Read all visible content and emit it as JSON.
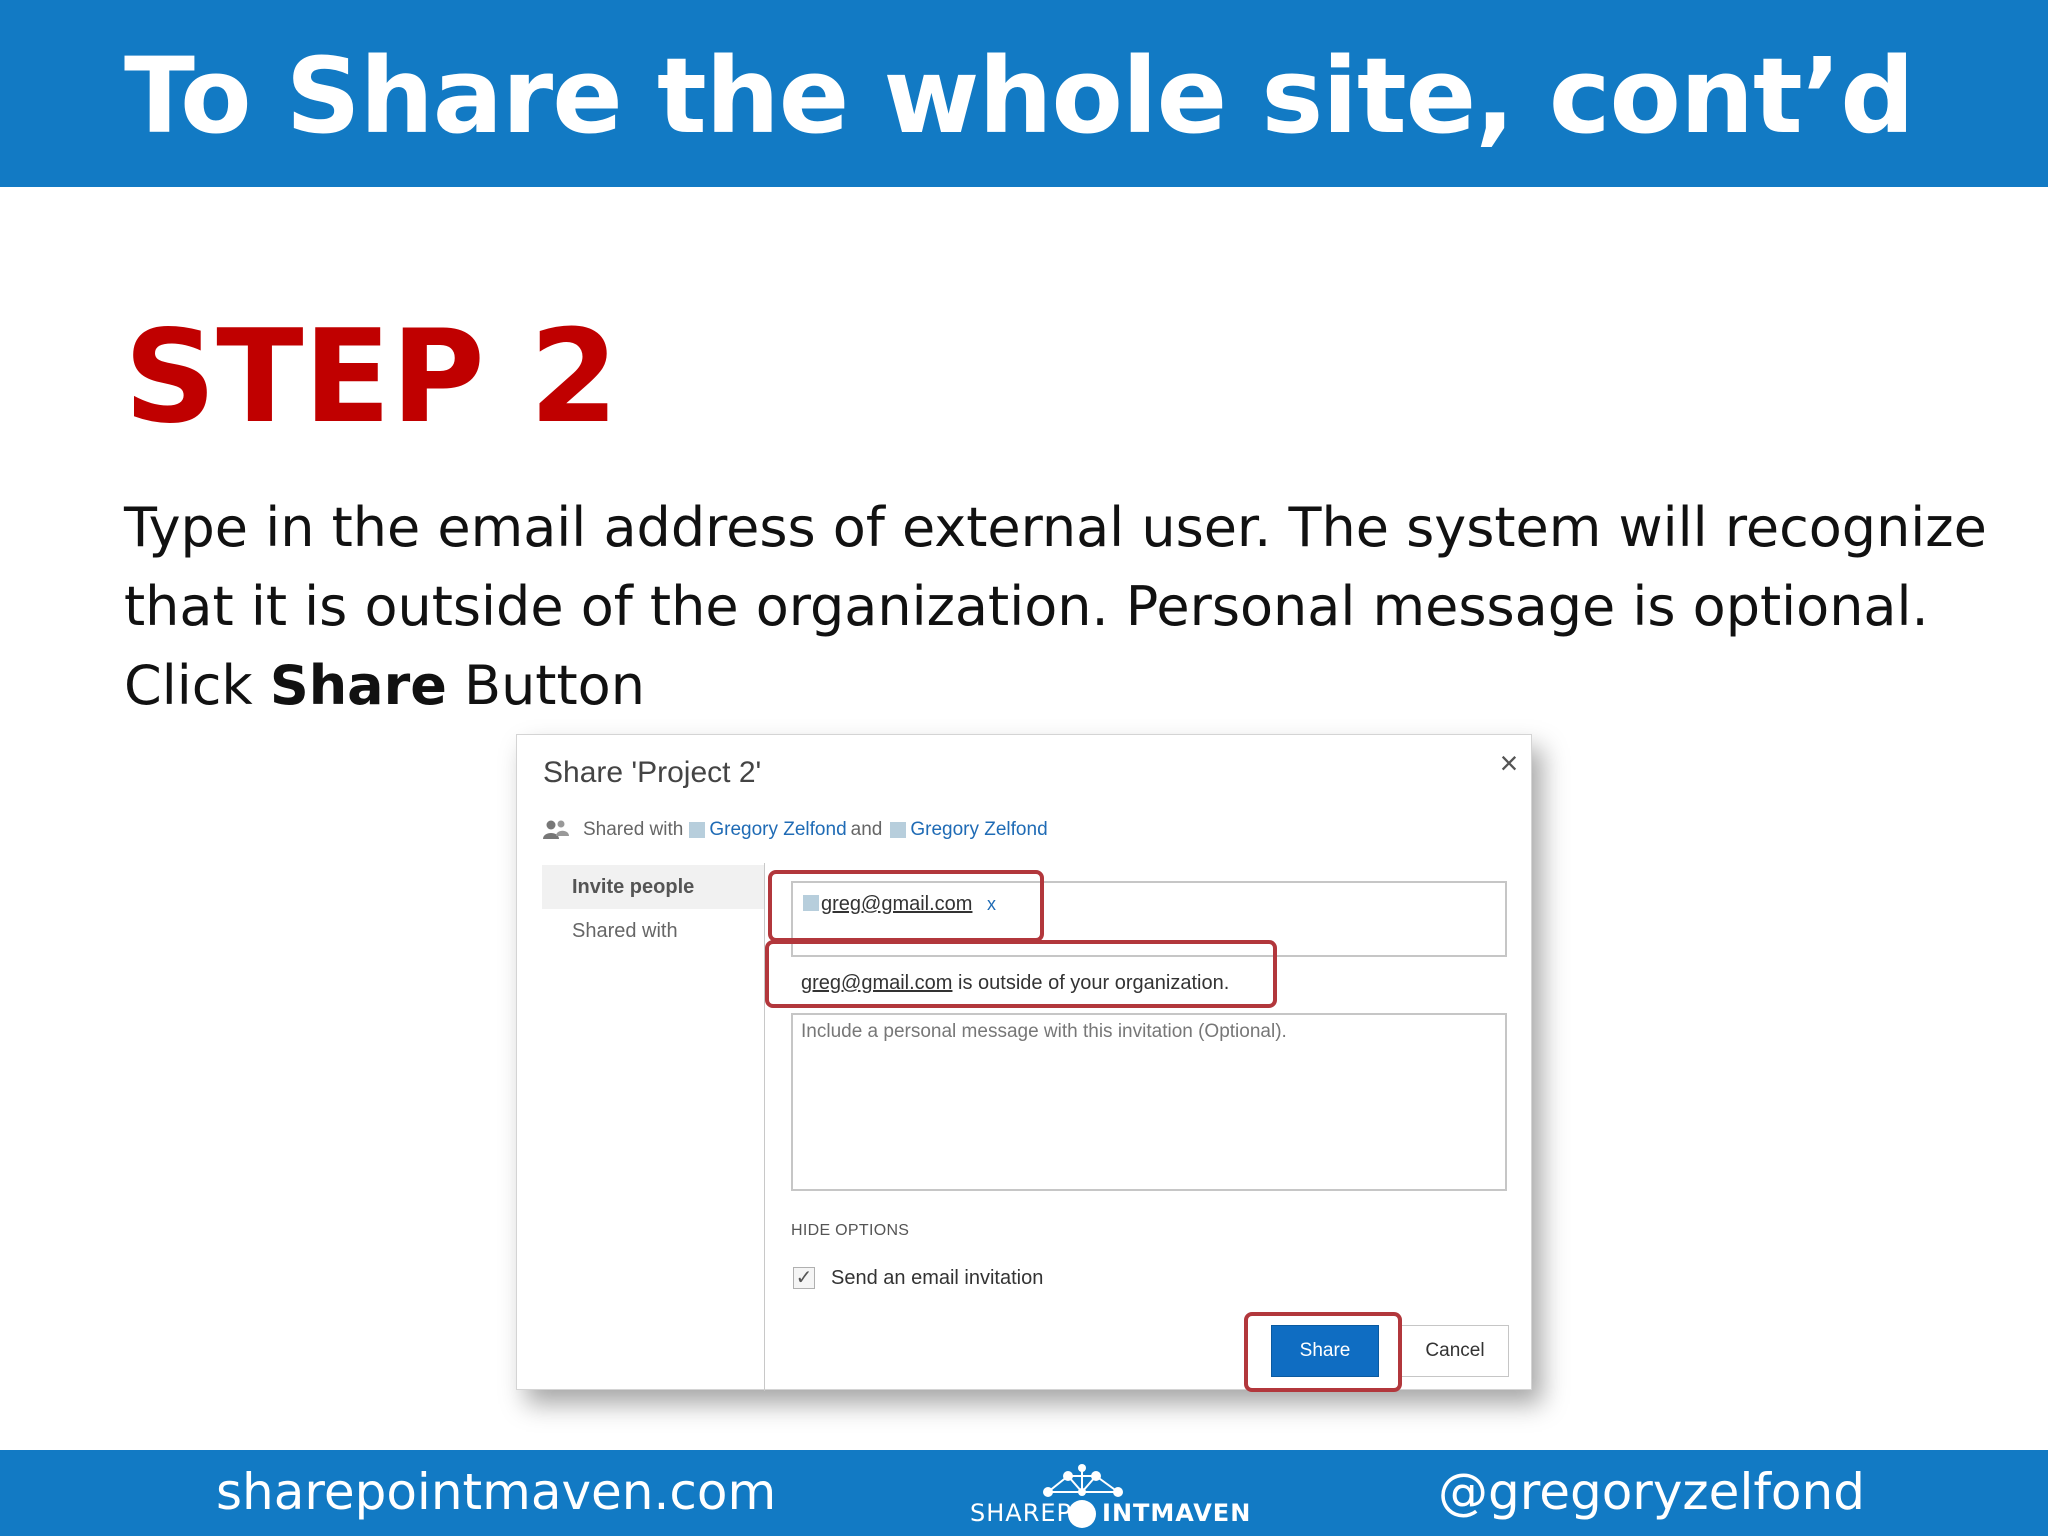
{
  "slide": {
    "title": "To Share the whole site, cont’d",
    "step_heading": "STEP 2",
    "instruction_before": "Type in the email address of external user. The system will recognize that it is outside of the organization. Personal message is optional. Click ",
    "instruction_bold": "Share",
    "instruction_after": " Button"
  },
  "dialog": {
    "title": "Share 'Project 2'",
    "close_glyph": "×",
    "shared_with_label": "Shared with",
    "shared_users": [
      "Gregory Zelfond",
      "Gregory Zelfond"
    ],
    "and_label": "and",
    "nav": {
      "invite_people": "Invite people",
      "shared_with": "Shared with"
    },
    "invite_token_email": "greg@gmail.com",
    "invite_token_remove": "x",
    "outside_email": "greg@gmail.com",
    "outside_text": " is outside of your organization.",
    "message_placeholder": "Include a personal message with this invitation (Optional).",
    "hide_options": "HIDE OPTIONS",
    "send_email_label": "Send an email invitation",
    "send_email_checked": true,
    "share_label": "Share",
    "cancel_label": "Cancel"
  },
  "footer": {
    "site": "sharepointmaven.com",
    "logo_left": "SHAREP",
    "logo_right": "INTMAVEN",
    "handle": "@gregoryzelfond"
  },
  "colors": {
    "brand_blue": "#127ac4",
    "step_red": "#c00000",
    "highlight_red": "#b2373c",
    "link_blue": "#1f6bb5"
  }
}
